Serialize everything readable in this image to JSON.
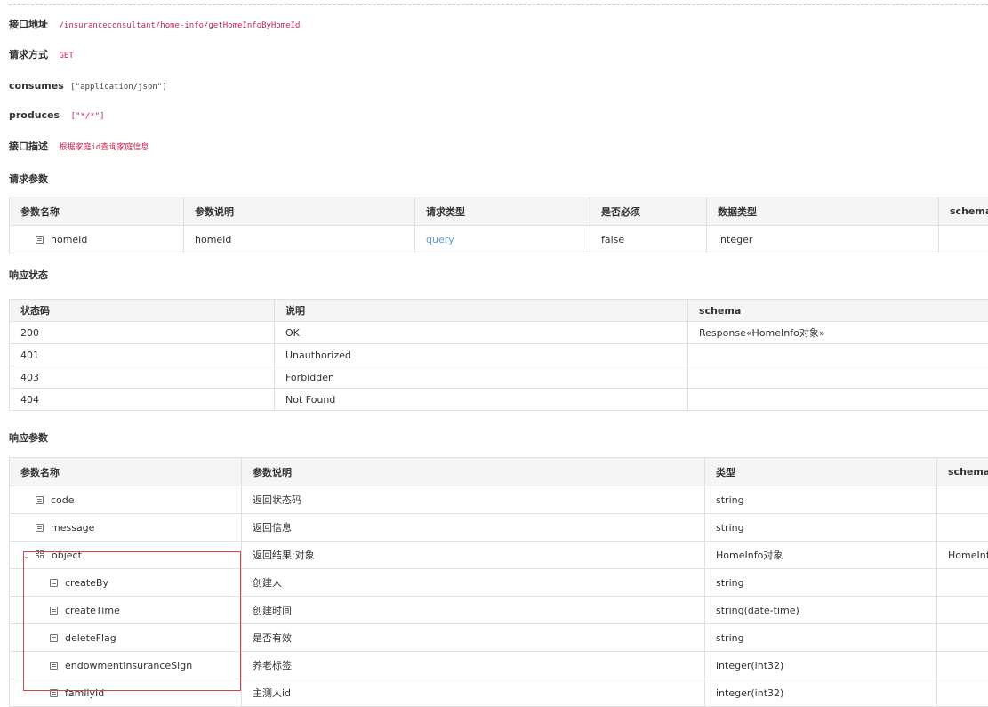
{
  "api": {
    "address_label": "接口地址",
    "address_value": "/insuranceconsultant/home-info/getHomeInfoByHomeId",
    "method_label": "请求方式",
    "method_value": "GET",
    "consumes_label": "consumes",
    "consumes_value": "[\"application/json\"]",
    "produces_label": "produces",
    "produces_value": "[\"*/*\"]",
    "desc_label": "接口描述",
    "desc_value": "根据家庭id查询家庭信息"
  },
  "request_params": {
    "title": "请求参数",
    "headers": [
      "参数名称",
      "参数说明",
      "请求类型",
      "是否必须",
      "数据类型",
      "schema"
    ],
    "rows": [
      {
        "name": "homeId",
        "desc": "homeId",
        "in": "query",
        "required": "false",
        "type": "integer",
        "schema": ""
      }
    ]
  },
  "response_status": {
    "title": "响应状态",
    "headers": [
      "状态码",
      "说明",
      "schema"
    ],
    "rows": [
      {
        "code": "200",
        "desc": "OK",
        "schema": "Response«HomeInfo对象»"
      },
      {
        "code": "401",
        "desc": "Unauthorized",
        "schema": ""
      },
      {
        "code": "403",
        "desc": "Forbidden",
        "schema": ""
      },
      {
        "code": "404",
        "desc": "Not Found",
        "schema": ""
      }
    ]
  },
  "response_params": {
    "title": "响应参数",
    "headers": [
      "参数名称",
      "参数说明",
      "类型",
      "schema"
    ],
    "rows": [
      {
        "name": "code",
        "desc": "返回状态码",
        "type": "string",
        "schema": ""
      },
      {
        "name": "message",
        "desc": "返回信息",
        "type": "string",
        "schema": ""
      },
      {
        "name": "object",
        "desc": "返回结果:对象",
        "type": "HomeInfo对象",
        "schema": "HomeInfo"
      },
      {
        "name": "createBy",
        "desc": "创建人",
        "type": "string",
        "schema": ""
      },
      {
        "name": "createTime",
        "desc": "创建时间",
        "type": "string(date-time)",
        "schema": ""
      },
      {
        "name": "deleteFlag",
        "desc": "是否有效",
        "type": "string",
        "schema": ""
      },
      {
        "name": "endowmentInsuranceSign",
        "desc": "养老标签",
        "type": "integer(int32)",
        "schema": ""
      },
      {
        "name": "familyId",
        "desc": "主测人id",
        "type": "integer(int32)",
        "schema": ""
      }
    ]
  },
  "colors": {
    "accent_link": "#5b9bd5",
    "code_text": "#c7254e",
    "highlight_box": "#d9434b"
  }
}
